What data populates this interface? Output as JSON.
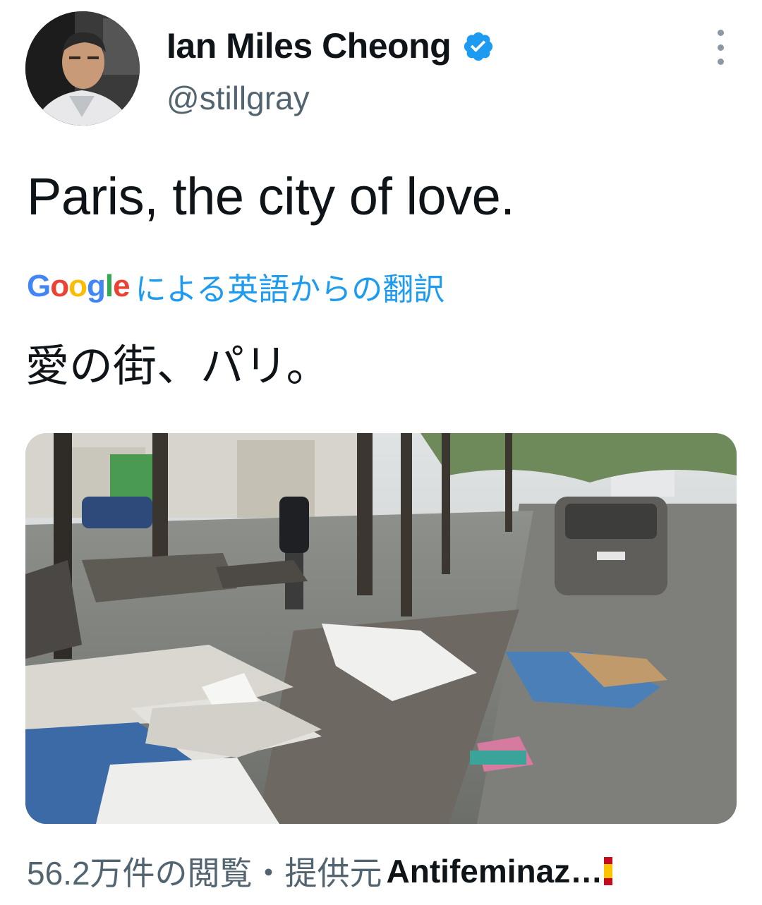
{
  "author": {
    "name": "Ian Miles Cheong",
    "handle": "@stillgray",
    "verified": true,
    "avatar_icon": "profile-photo"
  },
  "tweet": {
    "text": "Paris, the city of love."
  },
  "translation": {
    "provider": "Google",
    "label": "による英語からの翻訳",
    "text": "愛の街、パリ。"
  },
  "media": {
    "type": "video-thumbnail",
    "icon": "street-scene-image"
  },
  "footer": {
    "views": "56.2万件の閲覧",
    "separator": "・",
    "source_label": "提供元",
    "source_name": "Antifeminaz…"
  },
  "colors": {
    "link_blue": "#1d9bf0",
    "verified_blue": "#1d9bf0",
    "secondary_text": "#536471",
    "primary_text": "#0f1419"
  }
}
